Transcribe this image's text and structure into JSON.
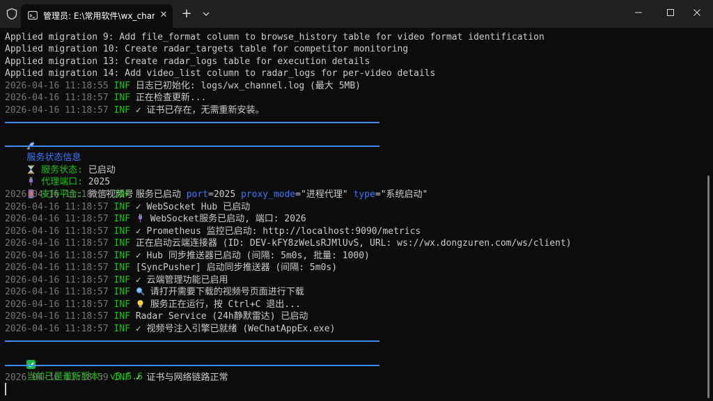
{
  "window": {
    "tab_title": "管理员: E:\\常用软件\\wx_chann",
    "tab_close": "✕",
    "new_tab": "+"
  },
  "colors": {
    "background": "#0c0c0c",
    "titlebar": "#202020",
    "timestamp": "#767676",
    "level": "#16c60c",
    "accent_blue": "#3b78ff",
    "rule": "#3b8eea"
  },
  "log": {
    "migrations": [
      "Applied migration 9: Add file_format column to browse_history table for video format identification",
      "Applied migration 10: Create radar_targets table for competitor monitoring",
      "Applied migration 13: Create radar_logs table for execution details",
      "Applied migration 14: Add video_list column to radar_logs for per-video details"
    ],
    "early": [
      {
        "ts": "2026-04-16 11:18:55",
        "level": "INF",
        "msg": "日志已初始化: logs/wx_channel.log (最大 5MB)"
      },
      {
        "ts": "2026-04-16 11:18:57",
        "level": "INF",
        "msg": "正在检查更新..."
      },
      {
        "ts": "2026-04-16 11:18:57",
        "level": "INF",
        "msg": "✓ 证书已存在，无需重新安装。"
      }
    ],
    "service_header": "服务状态信息",
    "service_status": {
      "status_label": "服务状态:",
      "status_value": "已启动",
      "port_label": "代理端口:",
      "port_value": "2025",
      "platform_label": "支持平台:",
      "platform_value": "微信视频号"
    },
    "service_started": {
      "ts": "2026-04-16 11:18:57",
      "level": "INF",
      "msg": "服务已启动",
      "port_key": "port",
      "port_val": "2025",
      "proxy_key": "proxy_mode",
      "proxy_val": "\"进程代理\"",
      "type_key": "type",
      "type_val": "\"系统启动\""
    },
    "main": [
      {
        "ts": "2026-04-16 11:18:57",
        "level": "INF",
        "msg": "✓ WebSocket Hub 已启动"
      },
      {
        "ts": "2026-04-16 11:18:57",
        "level": "INF",
        "msg": "WebSocket服务已启动, 端口: 2026"
      },
      {
        "ts": "2026-04-16 11:18:57",
        "level": "INF",
        "msg": "✓ Prometheus 监控已启动: http://localhost:9090/metrics"
      },
      {
        "ts": "2026-04-16 11:18:57",
        "level": "INF",
        "msg": "正在启动云端连接器 (ID: DEV-kFY8zWeLsRJMlUvS, URL: ws://wx.dongzuren.com/ws/client)"
      },
      {
        "ts": "2026-04-16 11:18:57",
        "level": "INF",
        "msg": "✓ Hub 同步推送器已启动 (间隔: 5m0s, 批量: 1000)"
      },
      {
        "ts": "2026-04-16 11:18:57",
        "level": "INF",
        "msg": "[SyncPusher] 启动同步推送器 (间隔: 5m0s)"
      },
      {
        "ts": "2026-04-16 11:18:57",
        "level": "INF",
        "msg": "✓ 云端管理功能已启用"
      },
      {
        "ts": "2026-04-16 11:18:57",
        "level": "INF",
        "msg": "请打开需要下载的视频号页面进行下载"
      },
      {
        "ts": "2026-04-16 11:18:57",
        "level": "INF",
        "msg": "服务正在运行，按 Ctrl+C 退出..."
      },
      {
        "ts": "2026-04-16 11:18:57",
        "level": "INF",
        "msg": "Radar Service (24h静默雷达) 已启动"
      },
      {
        "ts": "2026-04-16 11:18:57",
        "level": "INF",
        "msg": "✓ 视频号注入引擎已就绪 (WeChatAppEx.exe)"
      }
    ],
    "version_msg": "当前已是最新版本: v5.5.6",
    "final": {
      "ts": "2026-04-16 11:18:59",
      "level": "INF",
      "msg": "✓ 证书与网络链路正常"
    }
  }
}
